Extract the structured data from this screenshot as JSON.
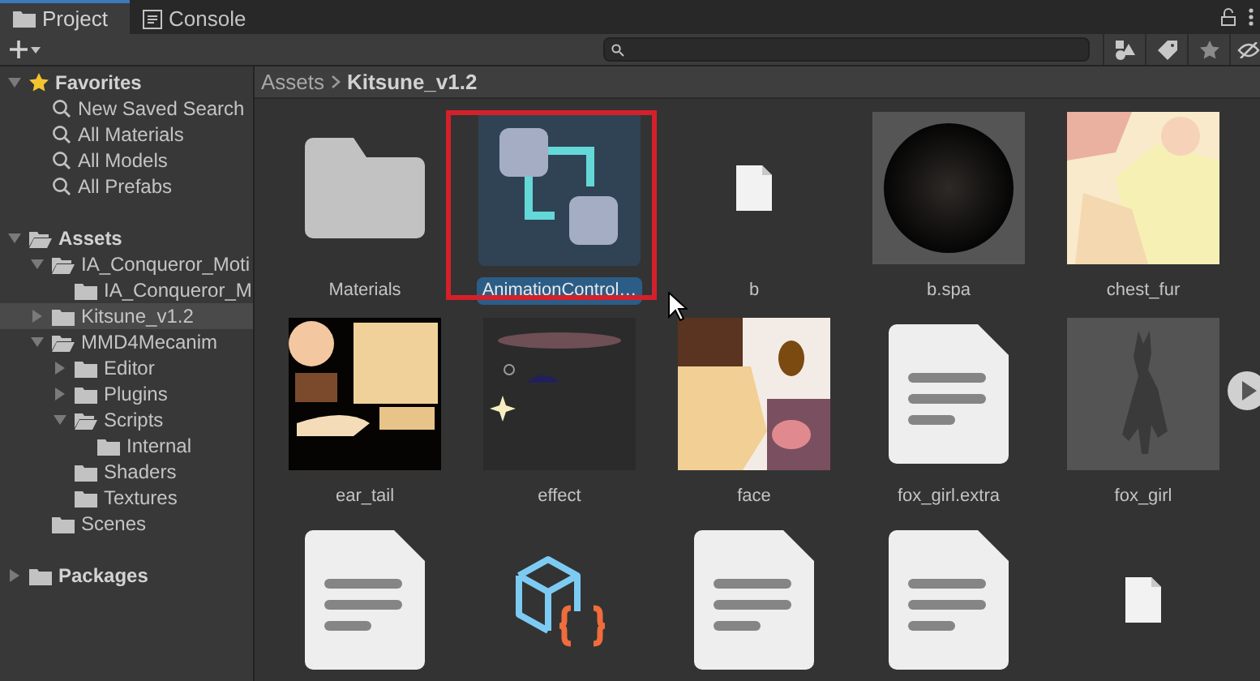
{
  "tabs": [
    {
      "label": "Project",
      "selected": true
    },
    {
      "label": "Console",
      "selected": false
    }
  ],
  "breadcrumb": [
    "Assets",
    "Kitsune_v1.2"
  ],
  "tree": [
    {
      "label": "Favorites",
      "kind": "favorites",
      "expanded": true,
      "selected": false,
      "children": [
        {
          "label": "New Saved Search",
          "kind": "search",
          "selected": false
        },
        {
          "label": "All Materials",
          "kind": "search",
          "selected": false
        },
        {
          "label": "All Models",
          "kind": "search",
          "selected": false
        },
        {
          "label": "All Prefabs",
          "kind": "search",
          "selected": false
        }
      ]
    },
    {
      "label": "Assets",
      "kind": "root",
      "expanded": true,
      "selected": false,
      "children": [
        {
          "label": "IA_Conqueror_Moti",
          "kind": "folder",
          "expanded": true,
          "selected": false,
          "children": [
            {
              "label": "IA_Conqueror_M",
              "kind": "folder",
              "selected": false
            }
          ]
        },
        {
          "label": "Kitsune_v1.2",
          "kind": "folder",
          "expanded": false,
          "selected": true
        },
        {
          "label": "MMD4Mecanim",
          "kind": "folder",
          "expanded": true,
          "selected": false,
          "children": [
            {
              "label": "Editor",
              "kind": "folder",
              "expanded": false,
              "selected": false
            },
            {
              "label": "Plugins",
              "kind": "folder",
              "expanded": false,
              "selected": false
            },
            {
              "label": "Scripts",
              "kind": "folder",
              "expanded": true,
              "selected": false,
              "children": [
                {
                  "label": "Internal",
                  "kind": "folder",
                  "selected": false
                }
              ]
            },
            {
              "label": "Shaders",
              "kind": "folder",
              "selected": false
            },
            {
              "label": "Textures",
              "kind": "folder",
              "selected": false
            }
          ]
        },
        {
          "label": "Scenes",
          "kind": "folder",
          "selected": false
        }
      ]
    },
    {
      "label": "Packages",
      "kind": "root",
      "expanded": false,
      "selected": false
    }
  ],
  "assets": [
    {
      "label": "Materials",
      "kind": "folder",
      "selected": false,
      "outlined": false
    },
    {
      "label": "AnimationControl…",
      "kind": "controller",
      "selected": true,
      "outlined": true
    },
    {
      "label": "b",
      "kind": "file",
      "selected": false,
      "outlined": false
    },
    {
      "label": "b.spa",
      "kind": "sphere",
      "selected": false,
      "outlined": false
    },
    {
      "label": "chest_fur",
      "kind": "texture",
      "selected": false,
      "outlined": false
    },
    {
      "label": "ear_tail",
      "kind": "texture",
      "selected": false,
      "outlined": false
    },
    {
      "label": "effect",
      "kind": "texture",
      "selected": false,
      "outlined": false
    },
    {
      "label": "face",
      "kind": "texture",
      "selected": false,
      "outlined": false
    },
    {
      "label": "fox_girl.extra",
      "kind": "document",
      "selected": false,
      "outlined": false
    },
    {
      "label": "fox_girl",
      "kind": "model",
      "selected": false,
      "outlined": false
    },
    {
      "kind": "document",
      "selected": false,
      "outlined": false
    },
    {
      "kind": "script",
      "selected": false,
      "outlined": false
    },
    {
      "kind": "document",
      "selected": false,
      "outlined": false
    },
    {
      "kind": "document",
      "selected": false,
      "outlined": false
    },
    {
      "kind": "file",
      "selected": false,
      "outlined": false
    }
  ]
}
